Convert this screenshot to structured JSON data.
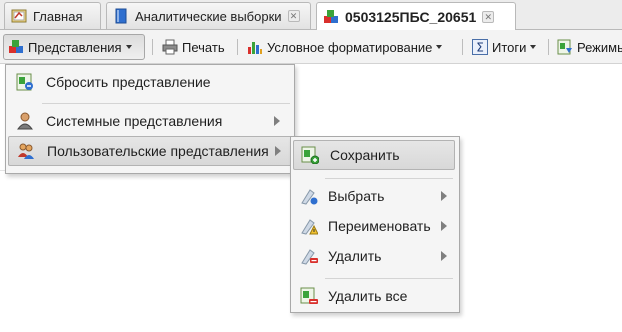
{
  "tabs": [
    {
      "label": "Главная",
      "icon": "home-icon"
    },
    {
      "label": "Аналитические выборки",
      "icon": "book-icon",
      "closable": true
    },
    {
      "label": "0503125ПБС_20651",
      "icon": "cubes-icon",
      "closable": true,
      "active": true
    }
  ],
  "toolbar": {
    "views_label": "Представления",
    "print_label": "Печать",
    "conditional_format_label": "Условное форматирование",
    "totals_label": "Итоги",
    "modes_label": "Режимы"
  },
  "views_menu": {
    "items": [
      {
        "label": "Сбросить представление",
        "icon": "reset-view-icon"
      },
      {
        "label": "Системные представления",
        "icon": "system-user-icon",
        "submenu": true
      },
      {
        "label": "Пользовательские представления",
        "icon": "users-icon",
        "submenu": true,
        "highlighted": true
      }
    ]
  },
  "user_views_menu": {
    "items": [
      {
        "label": "Сохранить",
        "icon": "save-view-icon",
        "highlighted": true
      },
      {
        "label": "Выбрать",
        "icon": "select-view-icon",
        "submenu": true
      },
      {
        "label": "Переименовать",
        "icon": "rename-view-icon",
        "submenu": true
      },
      {
        "label": "Удалить",
        "icon": "delete-view-icon",
        "submenu": true
      },
      {
        "label": "Удалить все",
        "icon": "delete-all-views-icon"
      }
    ]
  },
  "colors": {
    "accent_green": "#3aa33a",
    "accent_red": "#d9302c",
    "accent_blue": "#2f6fcf",
    "menu_bg": "#f5f5f5",
    "highlight": "#dcdcdc"
  }
}
